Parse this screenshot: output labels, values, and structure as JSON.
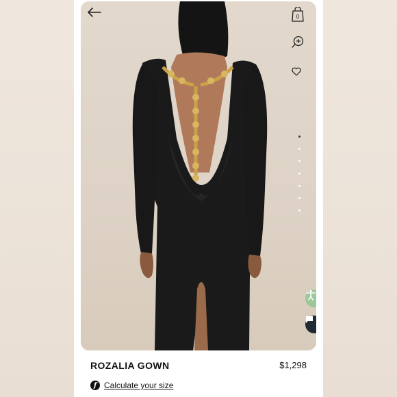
{
  "product": {
    "name": "ROZALIA GOWN",
    "price": "$1,298"
  },
  "size_helper": {
    "icon_letter": "f",
    "link_text": "Calculate your size"
  },
  "header": {
    "back_icon": "arrow-left-icon",
    "bag_icon": "shopping-bag-icon",
    "bag_count": "0",
    "zoom_icon": "zoom-in-icon",
    "wishlist_icon": "heart-icon"
  },
  "gallery": {
    "image_count": 7,
    "active_index": 0
  },
  "colors": {
    "accessibility_button": "#9cc79a",
    "chat_button": "#1f2a33",
    "dress": "#1a1a1a",
    "chain": "#c9a24a"
  }
}
